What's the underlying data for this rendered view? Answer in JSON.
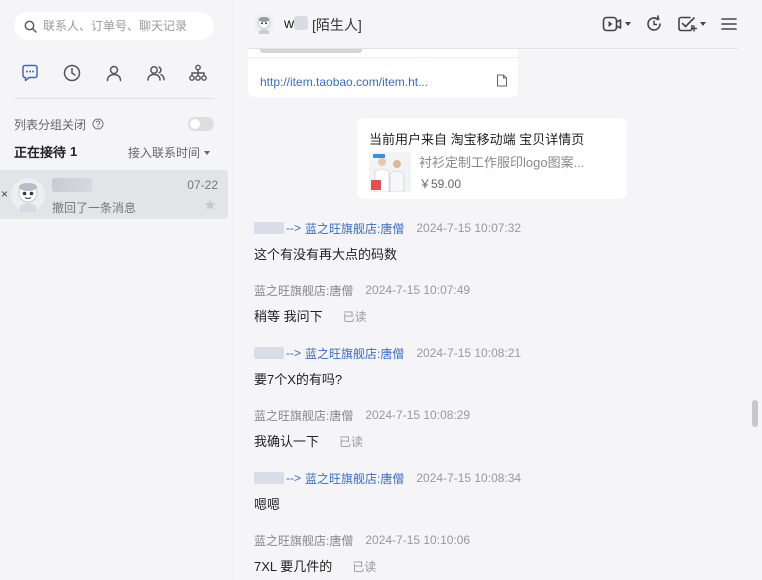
{
  "sidebar": {
    "search_placeholder": "联系人、订单号、聊天记录",
    "tabs": [
      {
        "id": "chat",
        "icon": "chat-bubble-icon",
        "active": true
      },
      {
        "id": "recent",
        "icon": "clock-icon",
        "active": false
      },
      {
        "id": "contacts",
        "icon": "person-icon",
        "active": false
      },
      {
        "id": "groups",
        "icon": "people-icon",
        "active": false
      },
      {
        "id": "org",
        "icon": "org-chart-icon",
        "active": false
      }
    ],
    "group_toggle_label": "列表分组关闭",
    "receiving_label": "正在接待",
    "receiving_count": "1",
    "sort_label": "接入联系时间",
    "conversation": {
      "name": "w",
      "date": "07-22",
      "preview": "撤回了一条消息"
    }
  },
  "header": {
    "name": "w",
    "tag": "[陌生人]"
  },
  "link_card": {
    "url": "http://item.taobao.com/item.ht..."
  },
  "product_card": {
    "title": "当前用户来自 淘宝移动端 宝贝详情页",
    "name": "衬衫定制工作服印logo图案...",
    "price": "￥59.00"
  },
  "messages": [
    {
      "from": "w",
      "arrow": "-->",
      "to": "蓝之旺旗舰店:唐僧",
      "time": "2024-7-15 10:07:32",
      "text": "这个有没有再大点的码数",
      "read": ""
    },
    {
      "from": "蓝之旺旗舰店:唐僧",
      "time": "2024-7-15 10:07:49",
      "text": "稍等 我问下",
      "read": "已读"
    },
    {
      "from": "w",
      "arrow": "-->",
      "to": "蓝之旺旗舰店:唐僧",
      "time": "2024-7-15 10:08:21",
      "text": "要7个X的有吗?",
      "read": ""
    },
    {
      "from": "蓝之旺旗舰店:唐僧",
      "time": "2024-7-15 10:08:29",
      "text": "我确认一下",
      "read": "已读"
    },
    {
      "from": "w",
      "arrow": "-->",
      "to": "蓝之旺旗舰店:唐僧",
      "time": "2024-7-15 10:08:34",
      "text": "嗯嗯",
      "read": ""
    },
    {
      "from": "蓝之旺旗舰店:唐僧",
      "time": "2024-7-15 10:10:06",
      "text": "7XL 要几件的",
      "read": "已读"
    }
  ],
  "colors": {
    "accent": "#3a6bc6",
    "sidebar_bg": "#f5f5f7",
    "selected_conv_bg": "#e3e4e8"
  }
}
